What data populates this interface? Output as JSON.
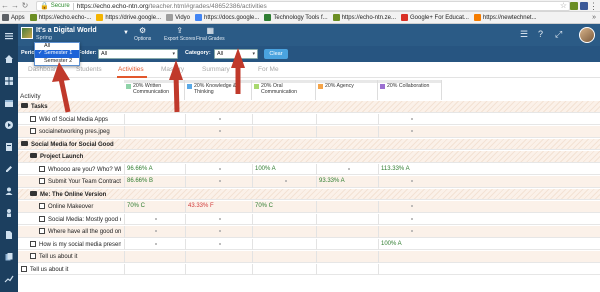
{
  "browser": {
    "secure_label": "Secure",
    "url_host": "https://echo.echo-ntn.org",
    "url_path": "/teacher.html#grades/48652386/activities",
    "bookmarks": [
      {
        "label": "Apps",
        "color": "#5f6368"
      },
      {
        "label": "https://echo.echo-...",
        "color": "#6b8e23"
      },
      {
        "label": "https://drive.google...",
        "color": "#f4b400"
      },
      {
        "label": "Vidyo",
        "color": "#9e9e9e"
      },
      {
        "label": "https://docs.google...",
        "color": "#4285f4"
      },
      {
        "label": "Technology Tools f...",
        "color": "#2e7d32"
      },
      {
        "label": "https://echo-ntn.ze...",
        "color": "#6b8e23"
      },
      {
        "label": "Google+ For Educat...",
        "color": "#d93025"
      },
      {
        "label": "https://newtechnet...",
        "color": "#f57c00"
      }
    ]
  },
  "header": {
    "course_title": "It's a Digital World",
    "course_sub": "Spring",
    "options_label": "Options",
    "export_label": "Export Scores",
    "final_label": "Final Grades"
  },
  "filters": {
    "period_label": "Period",
    "folder_label": "Folder:",
    "folder_value": "All",
    "category_label": "Category:",
    "category_value": "All",
    "clear_label": "Clear"
  },
  "dropdown": {
    "items": [
      "All",
      "Semester 1",
      "Semester 2"
    ],
    "selected": "Semester 1"
  },
  "tabs": [
    "Dashboard",
    "Students",
    "Activities",
    "Mastery",
    "Summary",
    "For Me"
  ],
  "activity_header": "Activity",
  "columns": [
    {
      "label": "20% Written Communication",
      "color": "#8fd3a8"
    },
    {
      "label": "20% Knowledge & Thinking",
      "color": "#5aa9e6"
    },
    {
      "label": "20% Oral Communication",
      "color": "#a8d86e"
    },
    {
      "label": "20% Agency",
      "color": "#f5a54a"
    },
    {
      "label": "20% Collaboration",
      "color": "#9b6fd1"
    }
  ],
  "rows": [
    {
      "type": "folder",
      "indent": 0,
      "name": "Tasks",
      "cells": [
        "",
        "",
        "",
        "",
        ""
      ]
    },
    {
      "type": "doc",
      "indent": 1,
      "name": "Wiki of Social Media Apps",
      "cells": [
        "",
        "dot",
        "",
        "",
        "dot"
      ]
    },
    {
      "type": "doc",
      "indent": 1,
      "name": "socialnetworking pres.jpeg",
      "cells": [
        "",
        "dot",
        "",
        "",
        "dot"
      ]
    },
    {
      "type": "folder",
      "indent": 0,
      "name": "Social Media for Social Good",
      "cells": [
        "",
        "",
        "",
        "",
        ""
      ]
    },
    {
      "type": "folder",
      "indent": 1,
      "name": "Project Launch",
      "cells": [
        "",
        "",
        "",
        "",
        ""
      ]
    },
    {
      "type": "doc",
      "indent": 2,
      "name": "Whoooo are you? Who? Wh",
      "cells": [
        "96.66% A",
        "dot",
        "100% A",
        "dot",
        "113.33% A"
      ]
    },
    {
      "type": "doc",
      "indent": 2,
      "name": "Submit Your Team Contract",
      "cells": [
        "86.66% B",
        "dot",
        "dot",
        "93.33% A",
        "dot"
      ]
    },
    {
      "type": "folder",
      "indent": 1,
      "name": "Me: The Online Version",
      "cells": [
        "",
        "",
        "",
        "",
        ""
      ]
    },
    {
      "type": "doc",
      "indent": 2,
      "name": "Online Makeover",
      "cells": [
        "70% C",
        "43.33% F",
        "70% C",
        "",
        "dot"
      ]
    },
    {
      "type": "doc",
      "indent": 2,
      "name": "Social Media: Mostly good o",
      "cells": [
        "dot",
        "dot",
        "",
        "",
        "dot"
      ]
    },
    {
      "type": "doc",
      "indent": 2,
      "name": "Where have all the good one",
      "cells": [
        "dot",
        "dot",
        "",
        "",
        "dot"
      ]
    },
    {
      "type": "doc",
      "indent": 1,
      "name": "How is my social media presenc",
      "cells": [
        "dot",
        "dot",
        "",
        "",
        "100% A"
      ]
    },
    {
      "type": "doc",
      "indent": 1,
      "name": "Tell us about it",
      "cells": [
        "",
        "",
        "",
        "",
        ""
      ]
    },
    {
      "type": "doc",
      "indent": 0,
      "name": "Tell us about it",
      "cells": [
        "",
        "",
        "",
        "",
        ""
      ]
    }
  ]
}
